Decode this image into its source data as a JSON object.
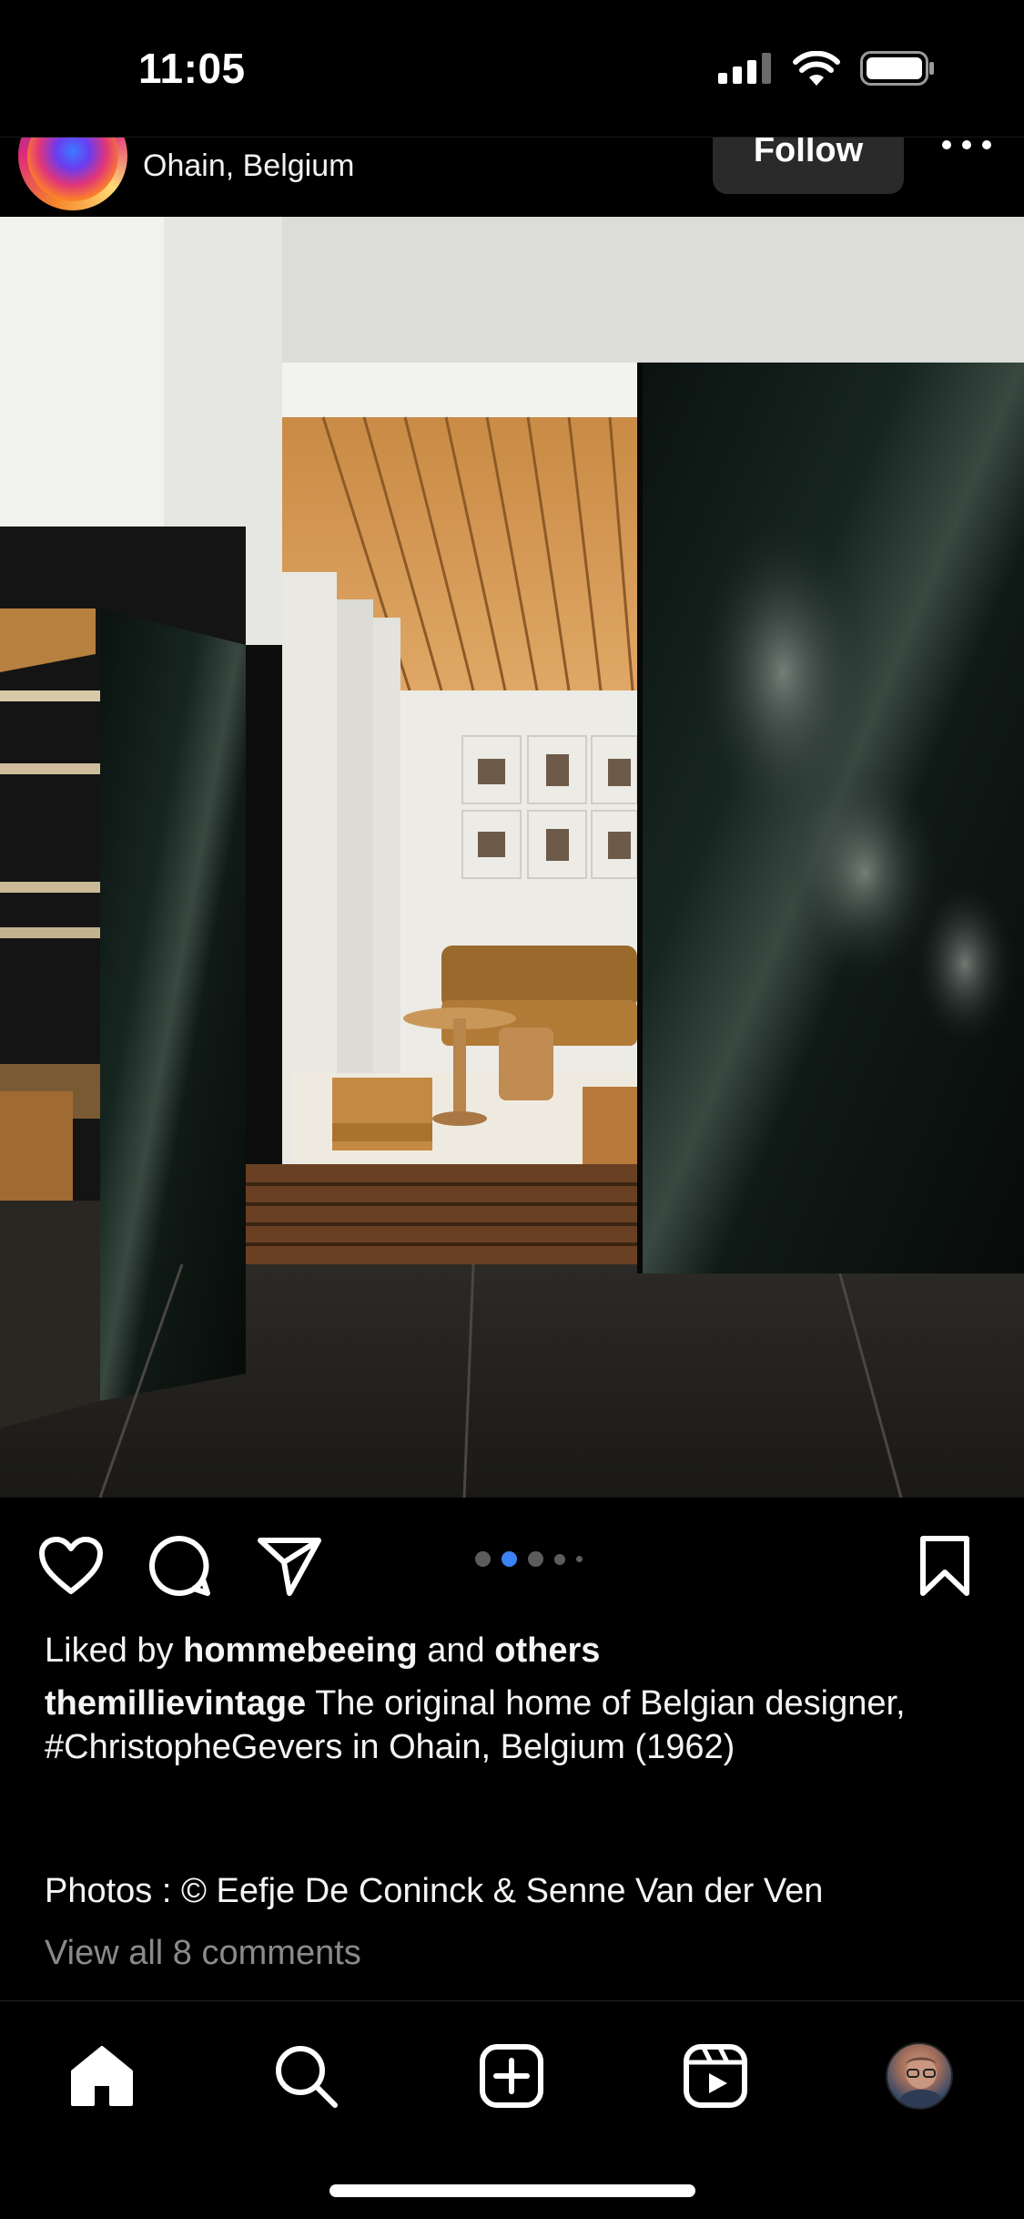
{
  "status_bar": {
    "time": "11:05"
  },
  "post": {
    "location": "Ohain, Belgium",
    "follow_label": "Follow",
    "carousel": {
      "count": 5,
      "active_index": 1
    },
    "likes": {
      "prefix": "Liked by",
      "user": "hommebeeing",
      "middle": "and",
      "others": "others"
    },
    "caption": {
      "username": "themillievintage",
      "text_1": "The original home of Belgian designer,",
      "hashtag": "#ChristopheGevers",
      "text_2": "in Ohain, Belgium (1962)",
      "credit": "Photos : © Eefje De Coninck & Senne Van der Ven"
    },
    "comments_link": "View all 8 comments"
  },
  "icons": {
    "like": "heart-icon",
    "comment": "comment-icon",
    "share": "send-icon",
    "save": "bookmark-icon",
    "home": "home-icon",
    "search": "search-icon",
    "create": "plus-square-icon",
    "reels": "reels-icon"
  }
}
